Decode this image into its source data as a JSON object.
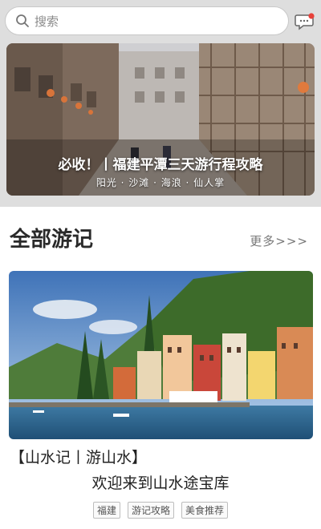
{
  "search": {
    "placeholder": "搜索",
    "icon": "search-icon"
  },
  "header": {
    "message_icon": "chat-bubble-icon",
    "badge_color": "#e8413a"
  },
  "banner": {
    "title": "必收！丨福建平潭三天游行程攻略",
    "subtitle": "阳光 · 沙滩 · 海浪 · 仙人掌"
  },
  "section": {
    "title": "全部游记",
    "more_label": "更多>>>"
  },
  "card": {
    "title": "【山水记丨游山水】",
    "subtitle": "欢迎来到山水途宝库",
    "tags": [
      "福建",
      "游记攻略",
      "美食推荐"
    ]
  }
}
